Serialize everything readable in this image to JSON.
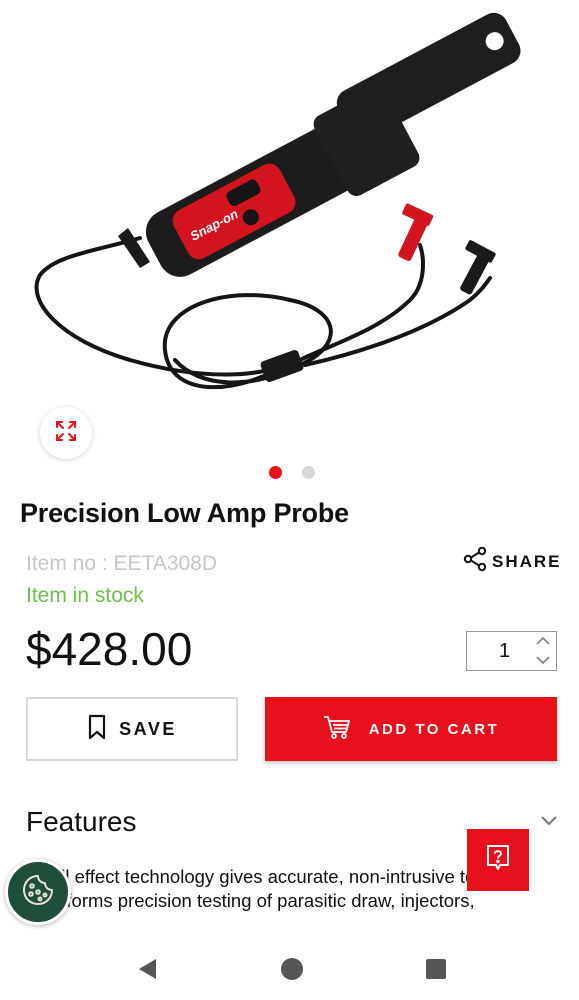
{
  "product": {
    "title": "Precision Low Amp Probe",
    "item_no": "Item no : EETA308D",
    "stock_status": "Item in stock",
    "price": "$428.00",
    "quantity": "1",
    "image_brand": "Snap-on",
    "image_index": 1,
    "image_count": 2
  },
  "actions": {
    "share_label": "SHARE",
    "save_label": "SAVE",
    "add_to_cart_label": "ADD TO CART"
  },
  "features": {
    "title": "Features",
    "items": [
      "• Hall effect technology gives accurate, non-intrusive testing",
      "• Performs precision testing of parasitic draw, injectors,"
    ]
  },
  "icons": {
    "zoom": "expand-icon",
    "share": "share-icon",
    "save": "bookmark-icon",
    "cart": "cart-icon",
    "help": "help-icon",
    "cookie": "cookie-icon",
    "chevron": "chevron-down-icon"
  },
  "colors": {
    "brand_red": "#e8101a",
    "stock_green": "#6cc04a",
    "muted_gray": "#c6c6c6",
    "cookie_green": "#1f4e3a"
  }
}
